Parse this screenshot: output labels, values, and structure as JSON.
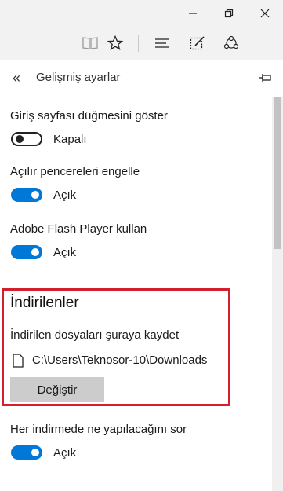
{
  "window": {
    "minimize_label": "—",
    "maximize_label": "❐",
    "close_label": "✕"
  },
  "toolbar": {
    "icons": [
      "reading-view-icon",
      "favorite-star-icon",
      "hub-icon",
      "web-note-icon",
      "share-icon"
    ]
  },
  "panel": {
    "back_label": "«",
    "title": "Gelişmiş ayarlar"
  },
  "settings": {
    "home_button": {
      "label": "Giriş sayfası düğmesini göster",
      "state": "Kapalı",
      "on": false
    },
    "popup_block": {
      "label": "Açılır pencereleri engelle",
      "state": "Açık",
      "on": true
    },
    "flash": {
      "label": "Adobe Flash Player kullan",
      "state": "Açık",
      "on": true
    }
  },
  "downloads": {
    "title": "İndirilenler",
    "save_label": "İndirilen dosyaları şuraya kaydet",
    "path": "C:\\Users\\Teknosor-10\\Downloads",
    "change_button": "Değiştir",
    "highlight_color": "#d3202f"
  },
  "ask_download": {
    "label": "Her indirmede ne yapılacağını sor",
    "state": "Açık",
    "on": true
  },
  "colors": {
    "accent": "#0078d7",
    "panel_bg": "#ffffff",
    "chrome_bg": "#f2f2f2"
  }
}
